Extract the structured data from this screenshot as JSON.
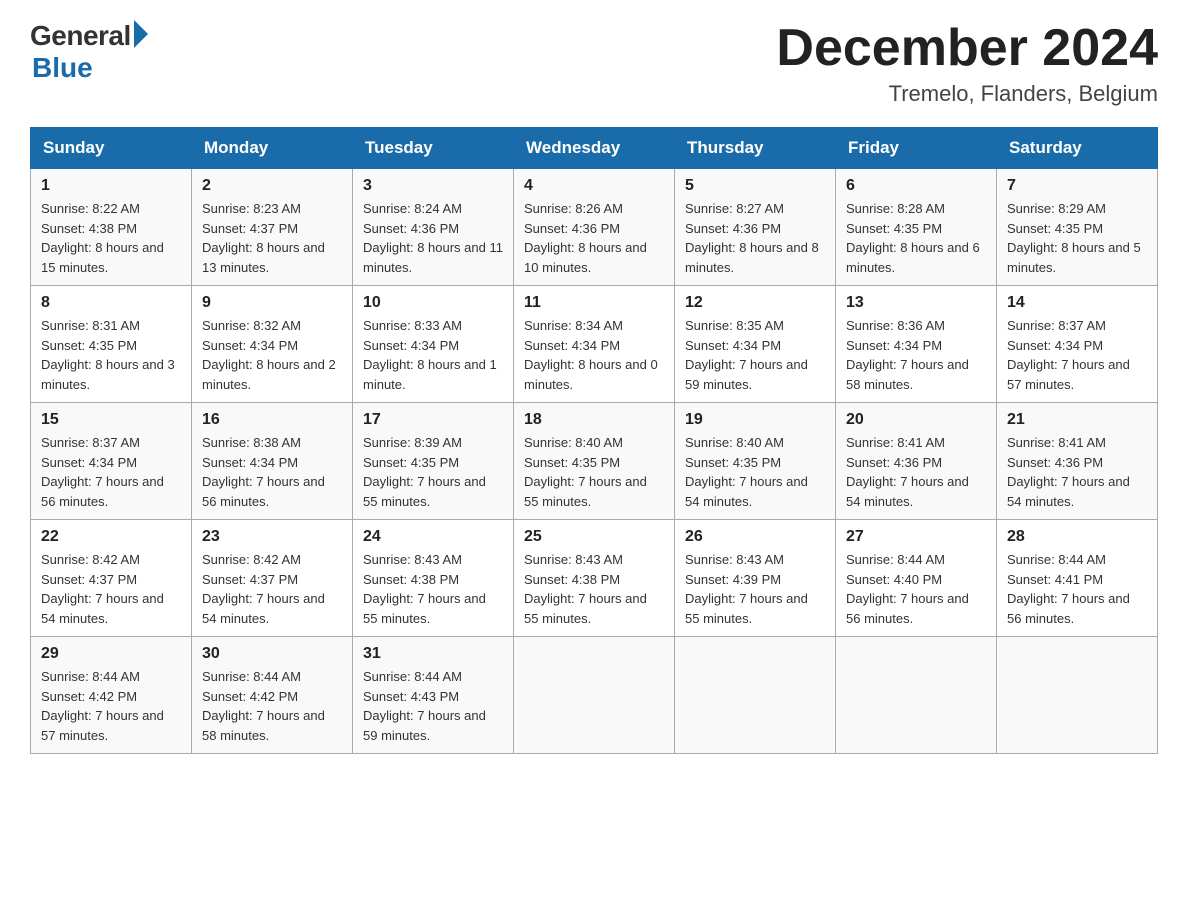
{
  "header": {
    "logo_general": "General",
    "logo_blue": "Blue",
    "month_title": "December 2024",
    "location": "Tremelo, Flanders, Belgium"
  },
  "days_of_week": [
    "Sunday",
    "Monday",
    "Tuesday",
    "Wednesday",
    "Thursday",
    "Friday",
    "Saturday"
  ],
  "weeks": [
    [
      {
        "day": "1",
        "sunrise": "8:22 AM",
        "sunset": "4:38 PM",
        "daylight": "8 hours and 15 minutes."
      },
      {
        "day": "2",
        "sunrise": "8:23 AM",
        "sunset": "4:37 PM",
        "daylight": "8 hours and 13 minutes."
      },
      {
        "day": "3",
        "sunrise": "8:24 AM",
        "sunset": "4:36 PM",
        "daylight": "8 hours and 11 minutes."
      },
      {
        "day": "4",
        "sunrise": "8:26 AM",
        "sunset": "4:36 PM",
        "daylight": "8 hours and 10 minutes."
      },
      {
        "day": "5",
        "sunrise": "8:27 AM",
        "sunset": "4:36 PM",
        "daylight": "8 hours and 8 minutes."
      },
      {
        "day": "6",
        "sunrise": "8:28 AM",
        "sunset": "4:35 PM",
        "daylight": "8 hours and 6 minutes."
      },
      {
        "day": "7",
        "sunrise": "8:29 AM",
        "sunset": "4:35 PM",
        "daylight": "8 hours and 5 minutes."
      }
    ],
    [
      {
        "day": "8",
        "sunrise": "8:31 AM",
        "sunset": "4:35 PM",
        "daylight": "8 hours and 3 minutes."
      },
      {
        "day": "9",
        "sunrise": "8:32 AM",
        "sunset": "4:34 PM",
        "daylight": "8 hours and 2 minutes."
      },
      {
        "day": "10",
        "sunrise": "8:33 AM",
        "sunset": "4:34 PM",
        "daylight": "8 hours and 1 minute."
      },
      {
        "day": "11",
        "sunrise": "8:34 AM",
        "sunset": "4:34 PM",
        "daylight": "8 hours and 0 minutes."
      },
      {
        "day": "12",
        "sunrise": "8:35 AM",
        "sunset": "4:34 PM",
        "daylight": "7 hours and 59 minutes."
      },
      {
        "day": "13",
        "sunrise": "8:36 AM",
        "sunset": "4:34 PM",
        "daylight": "7 hours and 58 minutes."
      },
      {
        "day": "14",
        "sunrise": "8:37 AM",
        "sunset": "4:34 PM",
        "daylight": "7 hours and 57 minutes."
      }
    ],
    [
      {
        "day": "15",
        "sunrise": "8:37 AM",
        "sunset": "4:34 PM",
        "daylight": "7 hours and 56 minutes."
      },
      {
        "day": "16",
        "sunrise": "8:38 AM",
        "sunset": "4:34 PM",
        "daylight": "7 hours and 56 minutes."
      },
      {
        "day": "17",
        "sunrise": "8:39 AM",
        "sunset": "4:35 PM",
        "daylight": "7 hours and 55 minutes."
      },
      {
        "day": "18",
        "sunrise": "8:40 AM",
        "sunset": "4:35 PM",
        "daylight": "7 hours and 55 minutes."
      },
      {
        "day": "19",
        "sunrise": "8:40 AM",
        "sunset": "4:35 PM",
        "daylight": "7 hours and 54 minutes."
      },
      {
        "day": "20",
        "sunrise": "8:41 AM",
        "sunset": "4:36 PM",
        "daylight": "7 hours and 54 minutes."
      },
      {
        "day": "21",
        "sunrise": "8:41 AM",
        "sunset": "4:36 PM",
        "daylight": "7 hours and 54 minutes."
      }
    ],
    [
      {
        "day": "22",
        "sunrise": "8:42 AM",
        "sunset": "4:37 PM",
        "daylight": "7 hours and 54 minutes."
      },
      {
        "day": "23",
        "sunrise": "8:42 AM",
        "sunset": "4:37 PM",
        "daylight": "7 hours and 54 minutes."
      },
      {
        "day": "24",
        "sunrise": "8:43 AM",
        "sunset": "4:38 PM",
        "daylight": "7 hours and 55 minutes."
      },
      {
        "day": "25",
        "sunrise": "8:43 AM",
        "sunset": "4:38 PM",
        "daylight": "7 hours and 55 minutes."
      },
      {
        "day": "26",
        "sunrise": "8:43 AM",
        "sunset": "4:39 PM",
        "daylight": "7 hours and 55 minutes."
      },
      {
        "day": "27",
        "sunrise": "8:44 AM",
        "sunset": "4:40 PM",
        "daylight": "7 hours and 56 minutes."
      },
      {
        "day": "28",
        "sunrise": "8:44 AM",
        "sunset": "4:41 PM",
        "daylight": "7 hours and 56 minutes."
      }
    ],
    [
      {
        "day": "29",
        "sunrise": "8:44 AM",
        "sunset": "4:42 PM",
        "daylight": "7 hours and 57 minutes."
      },
      {
        "day": "30",
        "sunrise": "8:44 AM",
        "sunset": "4:42 PM",
        "daylight": "7 hours and 58 minutes."
      },
      {
        "day": "31",
        "sunrise": "8:44 AM",
        "sunset": "4:43 PM",
        "daylight": "7 hours and 59 minutes."
      },
      null,
      null,
      null,
      null
    ]
  ]
}
